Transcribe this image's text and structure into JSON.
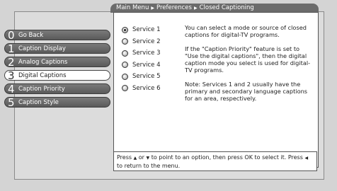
{
  "breadcrumb": {
    "items": [
      "Main Menu",
      "Preferences",
      "Closed Captioning"
    ],
    "separator": "▶"
  },
  "menu": {
    "items": [
      {
        "number": "0",
        "label": "Go Back"
      },
      {
        "number": "1",
        "label": "Caption Display"
      },
      {
        "number": "2",
        "label": "Analog Captions"
      },
      {
        "number": "3",
        "label": "Digital Captions",
        "selected": true
      },
      {
        "number": "4",
        "label": "Caption Priority"
      },
      {
        "number": "5",
        "label": "Caption Style"
      }
    ]
  },
  "services": {
    "items": [
      {
        "label": "Service 1",
        "selected": true
      },
      {
        "label": "Service 2"
      },
      {
        "label": "Service 3"
      },
      {
        "label": "Service 4"
      },
      {
        "label": "Service 5"
      },
      {
        "label": "Service 6"
      }
    ]
  },
  "description": {
    "paragraphs": [
      "You can select a mode or source of closed captions for digital-TV programs.",
      "If the \"Caption Priority\" feature is set to \"Use the digital captions\", then the digital caption mode you select is used for digital-TV programs.",
      "Note: Services 1 and 2 usually have the primary and secondary language captions for an area, respectively."
    ]
  },
  "help": {
    "part1": "Press",
    "up_glyph": "▲",
    "or": "or",
    "down_glyph": "▼",
    "part2": "to point to an option, then press OK to select it. Press",
    "left_glyph": "◀",
    "part3": "to return to the menu."
  }
}
